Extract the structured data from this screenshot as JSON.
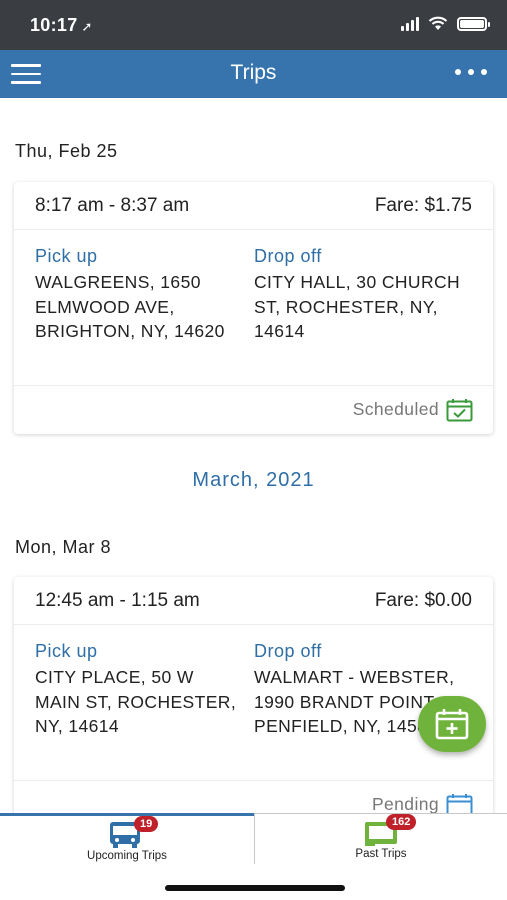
{
  "status_bar": {
    "time": "10:17",
    "location_glyph": "➚"
  },
  "header": {
    "title": "Trips",
    "menu_icon": "hamburger-icon",
    "more_icon": "more-dots-icon"
  },
  "trips": [
    {
      "date": "Thu, Feb 25",
      "time_range": "8:17 am - 8:37 am",
      "fare": "Fare: $1.75",
      "pickup_label": "Pick up",
      "pickup_address": "WALGREENS, 1650 ELMWOOD AVE, BRIGHTON, NY, 14620",
      "dropoff_label": "Drop off",
      "dropoff_address": "CITY HALL, 30 CHURCH ST, ROCHESTER, NY, 14614",
      "status": "Scheduled",
      "status_color": "#3a9a3a"
    },
    {
      "date": "Mon, Mar 8",
      "time_range": "12:45 am - 1:15 am",
      "fare": "Fare: $0.00",
      "pickup_label": "Pick up",
      "pickup_address": "CITY PLACE, 50 W MAIN ST, ROCHESTER, NY, 14614",
      "dropoff_label": "Drop off",
      "dropoff_address": "WALMART - WEBSTER, 1990 BRANDT POINT PENFIELD, NY, 14580",
      "status": "Pending",
      "status_color": "#3b8fd0"
    }
  ],
  "month_heading": "March, 2021",
  "fab": {
    "icon": "add-calendar-icon",
    "color": "#6fb33c"
  },
  "tabs": [
    {
      "label": "Upcoming Trips",
      "badge": "19",
      "icon": "bus-icon",
      "active": true
    },
    {
      "label": "Past Trips",
      "badge": "162",
      "icon": "ticket-icon",
      "active": false
    }
  ],
  "colors": {
    "header": "#3774ae",
    "status_bar": "#3a3d42",
    "accent_blue": "#2f6ea6",
    "badge_red": "#c0202a"
  }
}
